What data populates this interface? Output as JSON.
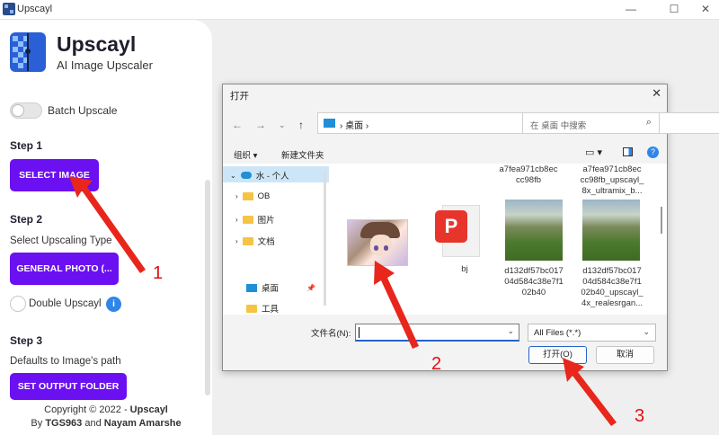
{
  "window": {
    "title": "Upscayl"
  },
  "brand": {
    "name": "Upscayl",
    "subtitle": "AI Image Upscaler"
  },
  "batch": {
    "label": "Batch Upscale"
  },
  "step1": {
    "title": "Step 1",
    "button": "SELECT IMAGE"
  },
  "step2": {
    "title": "Step 2",
    "hint": "Select Upscaling Type",
    "button": "GENERAL PHOTO (...",
    "double_label": "Double Upscayl",
    "info": "i"
  },
  "step3": {
    "title": "Step 3",
    "hint": "Defaults to Image's path",
    "button": "SET OUTPUT FOLDER"
  },
  "footer": {
    "copyright_prefix": "Copyright © 2022 - ",
    "copyright_brand": "Upscayl",
    "by": "By ",
    "author1": "TGS963",
    "and": " and ",
    "author2": "Nayam Amarshe"
  },
  "dialog": {
    "title": "打开",
    "address": "桌面",
    "search_placeholder": "在 桌面 中搜索",
    "toolbar": {
      "organize": "组织 ▾",
      "new_folder": "新建文件夹"
    },
    "nav": [
      "水 - 个人",
      "OB",
      "图片",
      "文档",
      "桌面",
      "工具"
    ],
    "files": {
      "top1": "a7fea971cb8ec\ncc98fb",
      "top2": "a7fea971cb8ec\ncc98fb_upscayl_\n8x_ultramix_b...",
      "pdf": "bj",
      "land1": "d132df57bc017\n04d584c38e7f1\n02b40",
      "land2": "d132df57bc017\n04d584c38e7f1\n02b40_upscayl_\n4x_realesrgan..."
    },
    "filename_label": "文件名(N):",
    "filename_value": "",
    "filetype": "All Files (*.*)",
    "open_button": "打开(O)",
    "cancel_button": "取消"
  },
  "annotations": [
    "1",
    "2",
    "3"
  ],
  "colors": {
    "accent": "#6b10f0",
    "arrow": "#e8261c"
  }
}
